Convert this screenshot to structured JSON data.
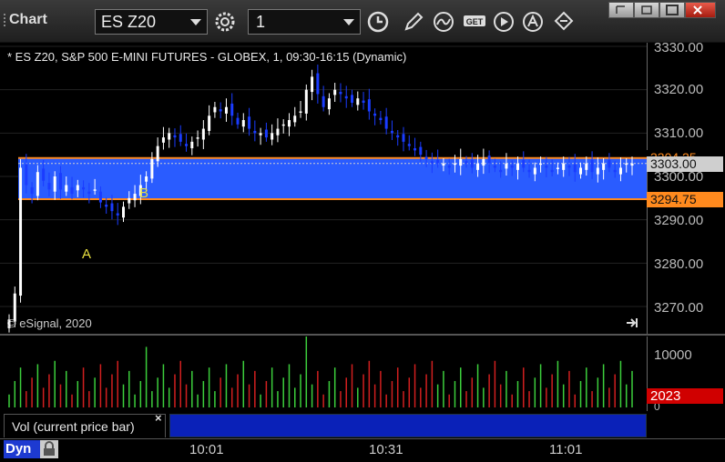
{
  "window": {
    "title": "Chart",
    "symbol": "ES Z20",
    "interval": "1"
  },
  "toolbar": {
    "icons": [
      "settings-gear-icon",
      "clock-icon",
      "pencil-draw-icon",
      "indicator-curve-icon",
      "get-data-icon",
      "play-icon",
      "alert-icon",
      "link-arrows-icon"
    ],
    "window_buttons": [
      "restore-icon",
      "duplicate-icon",
      "maximize-icon",
      "close-icon"
    ]
  },
  "chart": {
    "title": "* ES Z20, S&P 500 E-MINI FUTURES - GLOBEX, 1, 09:30-16:15 (Dynamic)",
    "copyright": "© eSignal, 2020",
    "marker_a": "A",
    "marker_b": "B",
    "price_labels": [
      "3330.00",
      "3320.00",
      "3310.00",
      "3300.00",
      "3290.00",
      "3280.00",
      "3270.00"
    ],
    "tag_upper": "3304.25",
    "tag_current": "3303.00",
    "tag_lower": "3294.75",
    "time_labels": [
      "10:01",
      "10:31",
      "11:01"
    ],
    "volume_labels": [
      "10000",
      "0"
    ],
    "volume_current": "2023",
    "study_label": "Vol (current price bar)",
    "study_close": "×",
    "mode": "Dyn",
    "colors": {
      "band": "#2a5cff",
      "band_line": "#ff8a1e",
      "up": "#ffffff",
      "down": "#1a3cff",
      "vol_up": "#3ccf3c",
      "vol_down": "#d21f1f",
      "tag_current": "#cfcfcf",
      "tag_lower": "#ff8a1e",
      "tag_vol": "#d00000"
    }
  },
  "chart_data": {
    "type": "candlestick",
    "title": "* ES Z20, S&P 500 E-MINI FUTURES - GLOBEX, 1, 09:30-16:15 (Dynamic)",
    "ylim": [
      3264,
      3332
    ],
    "band": {
      "upper": 3304.25,
      "lower": 3294.75,
      "current": 3303.0
    },
    "x_ticks": [
      "10:01",
      "10:31",
      "11:01"
    ],
    "closes": [
      3267,
      3273,
      3302,
      3298,
      3296,
      3301,
      3299,
      3297,
      3300,
      3297,
      3298,
      3296,
      3298,
      3297,
      3296,
      3297,
      3294,
      3293,
      3292,
      3291,
      3293,
      3295,
      3296,
      3298,
      3300,
      3304,
      3307,
      3309,
      3310,
      3309,
      3308,
      3307,
      3308,
      3309,
      3311,
      3314,
      3316,
      3315,
      3316,
      3314,
      3312,
      3313,
      3311,
      3310,
      3310,
      3309,
      3310,
      3311,
      3312,
      3313,
      3314,
      3315,
      3320,
      3323,
      3319,
      3316,
      3318,
      3320,
      3319,
      3318,
      3317,
      3318,
      3317,
      3315,
      3314,
      3313,
      3311,
      3310,
      3309,
      3308,
      3307,
      3306,
      3305,
      3304,
      3303,
      3303,
      3303,
      3302,
      3303,
      3304,
      3303,
      3302,
      3303,
      3304,
      3303,
      3302,
      3301,
      3303,
      3302,
      3303,
      3302,
      3301,
      3302,
      3303,
      3302,
      3301,
      3302,
      3303,
      3302,
      3301,
      3302,
      3303,
      3301,
      3302,
      3303,
      3302,
      3301,
      3302,
      3303,
      3303
    ],
    "volume_ylim": [
      0,
      13000
    ]
  }
}
